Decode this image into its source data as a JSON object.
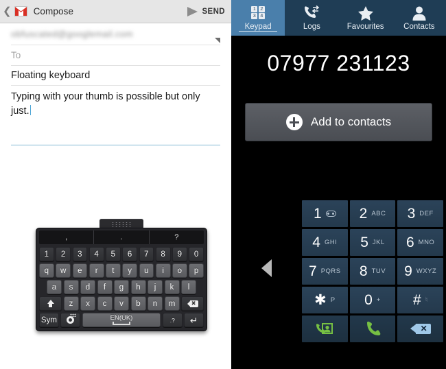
{
  "gmail": {
    "back_icon": "chevron-left-icon",
    "logo_icon": "gmail-logo-icon",
    "title": "Compose",
    "send_icon": "send-arrow-icon",
    "send_label": "SEND",
    "from_value": "obfuscated@googlemail.com",
    "from_expand_icon": "expand-triangle-icon",
    "to_placeholder": "To",
    "subject_value": "Floating keyboard",
    "body_value": "Typing with your thumb is possible but only just.",
    "accent_focus": "#7fb8d4"
  },
  "keyboard": {
    "handle_icon": "drag-handle-icon",
    "suggestions": [
      ",",
      ".",
      "?"
    ],
    "row_numbers": [
      "1",
      "2",
      "3",
      "4",
      "5",
      "6",
      "7",
      "8",
      "9",
      "0"
    ],
    "row_top": [
      "q",
      "w",
      "e",
      "r",
      "t",
      "y",
      "u",
      "i",
      "o",
      "p"
    ],
    "row_home": [
      "a",
      "s",
      "d",
      "f",
      "g",
      "h",
      "j",
      "k",
      "l"
    ],
    "row_bottom": [
      "z",
      "x",
      "c",
      "v",
      "b",
      "n",
      "m"
    ],
    "shift_icon": "shift-arrow-icon",
    "backspace_icon": "backspace-icon",
    "sym_label": "Sym",
    "settings_icon": "gear-icon",
    "space_label": "EN(UK)",
    "space_icon": "spacebar-icon",
    "punct_label": ".?",
    "enter_icon": "enter-return-icon"
  },
  "phone": {
    "tabs": [
      {
        "label": "Keypad",
        "icon": "keypad-grid-icon",
        "active": true
      },
      {
        "label": "Logs",
        "icon": "call-logs-icon",
        "active": false
      },
      {
        "label": "Favourites",
        "icon": "star-icon",
        "active": false
      },
      {
        "label": "Contacts",
        "icon": "person-icon",
        "active": false
      }
    ],
    "tab_icon_glyphs": [
      "",
      "✆",
      "★",
      "👤"
    ],
    "keypad_digits": [
      "1",
      "2",
      "3",
      "4"
    ],
    "number": "07977 231123",
    "add_contacts_label": "Add to contacts",
    "add_contacts_icon": "plus-circle-icon",
    "collapse_icon": "triangle-left-icon",
    "keys": [
      {
        "num": "1",
        "sub": "",
        "sub_icon": "voicemail-icon"
      },
      {
        "num": "2",
        "sub": "ABC",
        "sub_icon": ""
      },
      {
        "num": "3",
        "sub": "DEF",
        "sub_icon": ""
      },
      {
        "num": "4",
        "sub": "GHI",
        "sub_icon": ""
      },
      {
        "num": "5",
        "sub": "JKL",
        "sub_icon": ""
      },
      {
        "num": "6",
        "sub": "MNO",
        "sub_icon": ""
      },
      {
        "num": "7",
        "sub": "PQRS",
        "sub_icon": ""
      },
      {
        "num": "8",
        "sub": "TUV",
        "sub_icon": ""
      },
      {
        "num": "9",
        "sub": "WXYZ",
        "sub_icon": ""
      },
      {
        "num": "✱",
        "sub": "P",
        "sub_icon": ""
      },
      {
        "num": "0",
        "sub": "+",
        "sub_icon": ""
      },
      {
        "num": "#",
        "sub": "",
        "sub_icon": "mute-icon"
      }
    ],
    "actions": [
      {
        "icon": "video-call-contact-icon",
        "glyph": "☎",
        "color": "#76c043"
      },
      {
        "icon": "call-handset-icon",
        "glyph": "✆",
        "color": "#76c043"
      },
      {
        "icon": "backspace-icon",
        "glyph": "",
        "color": "#9fc8e8"
      }
    ],
    "colors": {
      "tabbar": "#1f3d55",
      "tab_active": "#4a7fab",
      "key": "#2b4359",
      "accent_green": "#76c043"
    }
  }
}
